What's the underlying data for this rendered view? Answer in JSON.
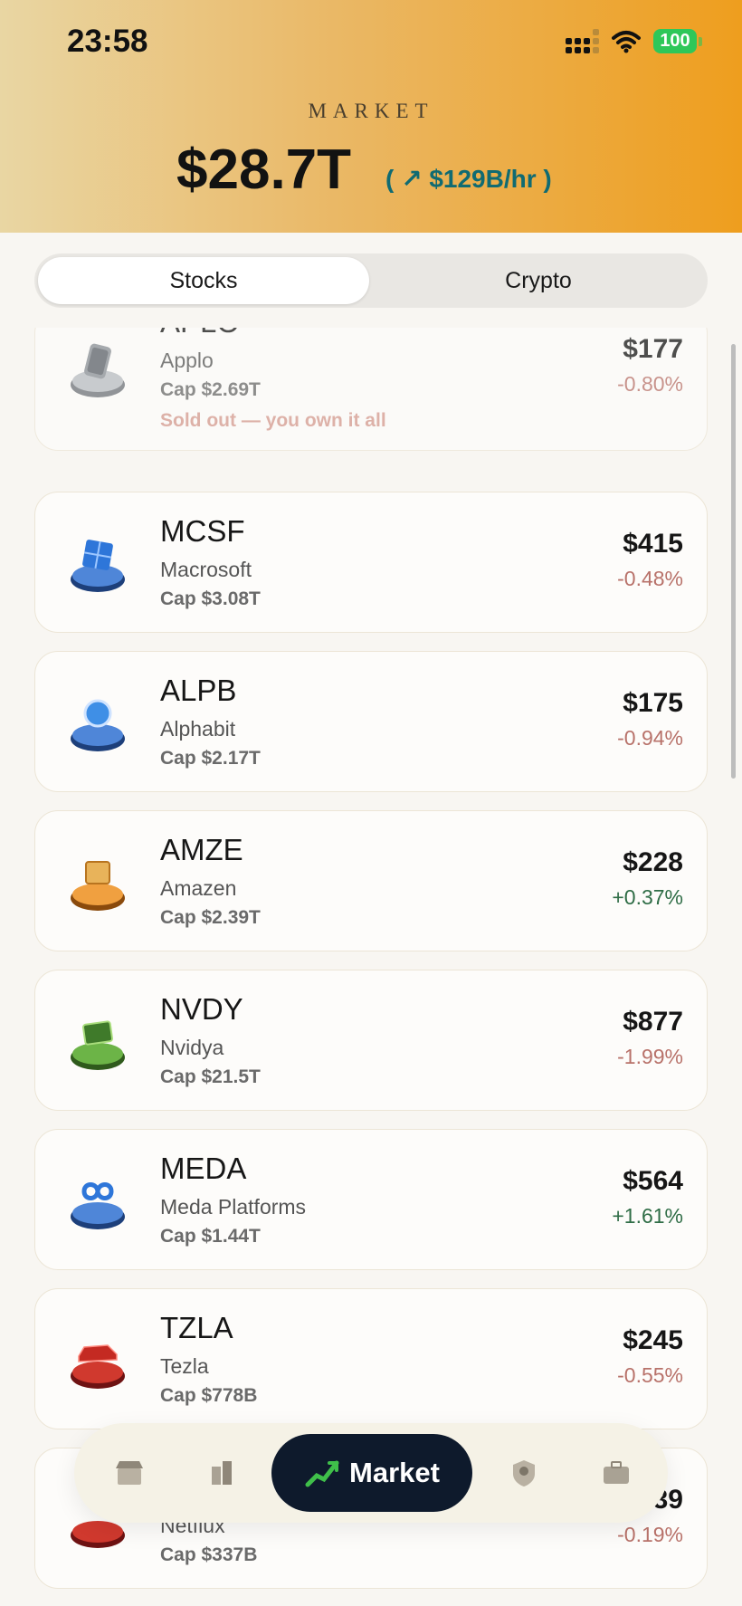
{
  "status": {
    "time": "23:58",
    "battery": "100"
  },
  "header": {
    "label": "MARKET",
    "total": "$28.7T",
    "rate": "( ↗ $129B/hr )"
  },
  "tabs": {
    "stocks": "Stocks",
    "crypto": "Crypto"
  },
  "stocks": [
    {
      "ticker": "APLO",
      "name": "Applo",
      "cap": "Cap $2.69T",
      "price": "$177",
      "change": "-0.80%",
      "note": "Sold out — you own it all",
      "icon": "phone-icon"
    },
    {
      "ticker": "MCSF",
      "name": "Macrosoft",
      "cap": "Cap $3.08T",
      "price": "$415",
      "change": "-0.48%",
      "icon": "windows-icon"
    },
    {
      "ticker": "ALPB",
      "name": "Alphabit",
      "cap": "Cap $2.17T",
      "price": "$175",
      "change": "-0.94%",
      "icon": "search-globe-icon"
    },
    {
      "ticker": "AMZE",
      "name": "Amazen",
      "cap": "Cap $2.39T",
      "price": "$228",
      "change": "+0.37%",
      "icon": "package-icon"
    },
    {
      "ticker": "NVDY",
      "name": "Nvidya",
      "cap": "Cap $21.5T",
      "price": "$877",
      "change": "-1.99%",
      "icon": "gpu-icon"
    },
    {
      "ticker": "MEDA",
      "name": "Meda Platforms",
      "cap": "Cap $1.44T",
      "price": "$564",
      "change": "+1.61%",
      "icon": "infinity-icon"
    },
    {
      "ticker": "TZLA",
      "name": "Tezla",
      "cap": "Cap $778B",
      "price": "$245",
      "change": "-0.55%",
      "icon": "car-icon"
    },
    {
      "ticker": "",
      "name": "Netflux",
      "cap": "Cap $337B",
      "price": "$...39",
      "change": "-0.19%",
      "icon": "film-icon"
    }
  ],
  "nav": {
    "active_label": "Market",
    "items": [
      "store-icon",
      "buildings-icon",
      "chart-up-icon",
      "shield-person-icon",
      "briefcase-icon"
    ]
  },
  "colors": {
    "accent": "#0e1a2c",
    "positive": "#2f6d46",
    "negative": "#b8726a",
    "rate": "#106b72"
  }
}
